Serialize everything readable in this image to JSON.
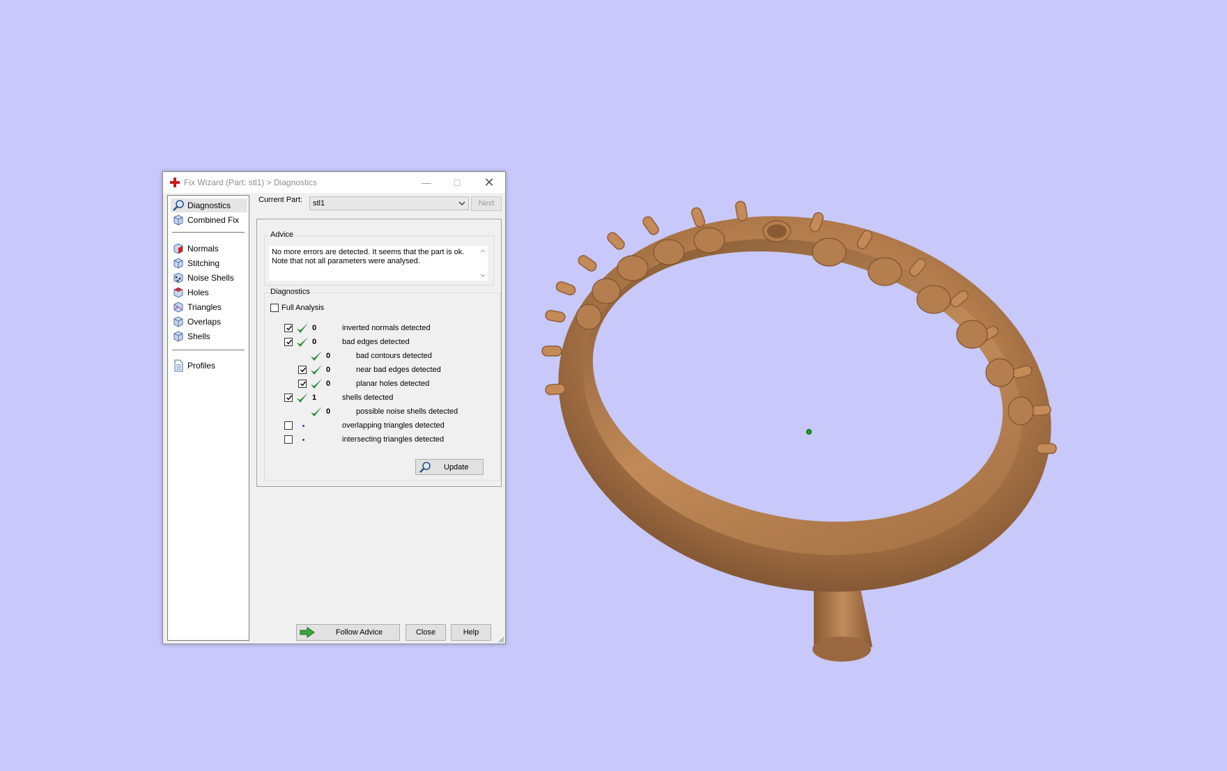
{
  "window": {
    "title": "Fix Wizard (Part: stl1) > Diagnostics"
  },
  "nav": {
    "items": [
      {
        "label": "Diagnostics",
        "icon": "magnifier-icon"
      },
      {
        "label": "Combined Fix",
        "icon": "cube-icon"
      },
      {
        "label": "Normals",
        "icon": "normals-cube-icon"
      },
      {
        "label": "Stitching",
        "icon": "stitching-cube-icon"
      },
      {
        "label": "Noise Shells",
        "icon": "noise-shells-icon"
      },
      {
        "label": "Holes",
        "icon": "holes-cube-icon"
      },
      {
        "label": "Triangles",
        "icon": "triangles-cube-icon"
      },
      {
        "label": "Overlaps",
        "icon": "overlaps-cube-icon"
      },
      {
        "label": "Shells",
        "icon": "shells-cube-icon"
      },
      {
        "label": "Profiles",
        "icon": "document-icon"
      }
    ],
    "selected": "Diagnostics"
  },
  "current_part": {
    "label": "Current Part:",
    "value": "stl1",
    "next_label": "Next"
  },
  "advice": {
    "title": "Advice",
    "text_line1": "No more errors are detected. It seems that the part is ok.",
    "text_line2": "Note that not all parameters were analysed."
  },
  "diagnostics": {
    "title": "Diagnostics",
    "full_analysis_label": "Full Analysis",
    "full_analysis_checked": false,
    "rows": [
      {
        "checked": true,
        "status": "ok",
        "count": "0",
        "text": "inverted normals detected"
      },
      {
        "checked": true,
        "status": "ok",
        "count": "0",
        "text": "bad edges detected"
      },
      {
        "checked": null,
        "status": "ok",
        "count": "0",
        "text": "bad contours detected"
      },
      {
        "checked": true,
        "status": "ok",
        "count": "0",
        "text": "near bad edges detected"
      },
      {
        "checked": true,
        "status": "ok",
        "count": "0",
        "text": "planar holes detected"
      },
      {
        "checked": true,
        "status": "ok",
        "count": "1",
        "text": "shells detected"
      },
      {
        "checked": null,
        "status": "ok",
        "count": "0",
        "text": "possible noise shells detected"
      },
      {
        "checked": false,
        "status": "not-run",
        "count": "",
        "text": "overlapping triangles detected"
      },
      {
        "checked": false,
        "status": "not-run",
        "count": "",
        "text": "intersecting triangles detected"
      }
    ],
    "update_label": "Update"
  },
  "buttons": {
    "follow_advice": "Follow Advice",
    "close": "Close",
    "help": "Help"
  },
  "colors": {
    "viewport_background": "#c8c8fa",
    "ring_copper": "#b07a4a",
    "check_green": "#2a8a3a",
    "pivot_dot": "#1aa01a"
  }
}
